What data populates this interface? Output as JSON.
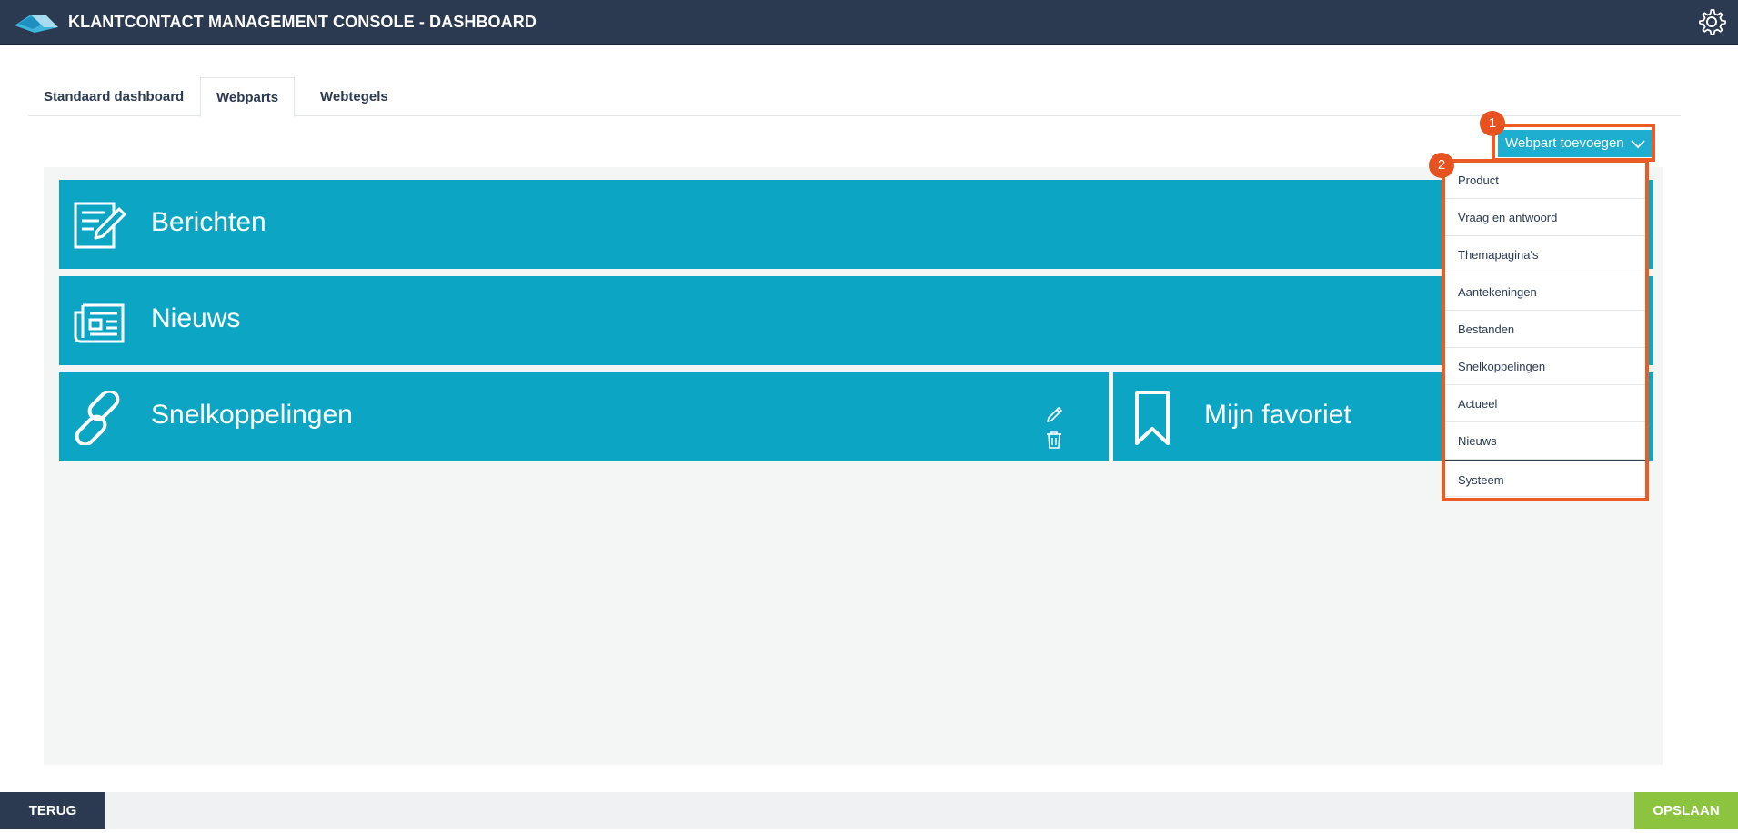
{
  "header": {
    "title": "KLANTCONTACT MANAGEMENT CONSOLE - DASHBOARD",
    "logo_icon": "logo-icon",
    "settings_icon": "gear-icon"
  },
  "tabs": [
    {
      "label": "Standaard dashboard",
      "active": false
    },
    {
      "label": "Webparts",
      "active": true
    },
    {
      "label": "Webtegels",
      "active": false
    }
  ],
  "add_webpart": {
    "label": "Webpart toevoegen",
    "icon": "chevron-down-icon"
  },
  "annotations": {
    "badge1": "1",
    "badge2": "2",
    "highlight_color": "#ea5b25"
  },
  "dropdown": {
    "items": [
      "Product",
      "Vraag en antwoord",
      "Themapagina's",
      "Aantekeningen",
      "Bestanden",
      "Snelkoppelingen",
      "Actueel",
      "Nieuws",
      "Systeem"
    ],
    "selected": "Systeem"
  },
  "webparts": [
    {
      "title": "Berichten",
      "icon": "note-edit-icon"
    },
    {
      "title": "Nieuws",
      "icon": "newspaper-icon"
    },
    {
      "title": "Snelkoppelingen",
      "icon": "link-icon",
      "actions": [
        "pencil-icon",
        "trash-icon"
      ]
    },
    {
      "title": "Mijn favoriet",
      "icon": "bookmark-icon"
    }
  ],
  "footer": {
    "back_label": "TERUG",
    "save_label": "OPSLAAN"
  },
  "colors": {
    "header": "#2c3a51",
    "tile": "#0ca6c4",
    "button": "#1daed0",
    "save": "#8cc33f",
    "annotation": "#e75320"
  }
}
